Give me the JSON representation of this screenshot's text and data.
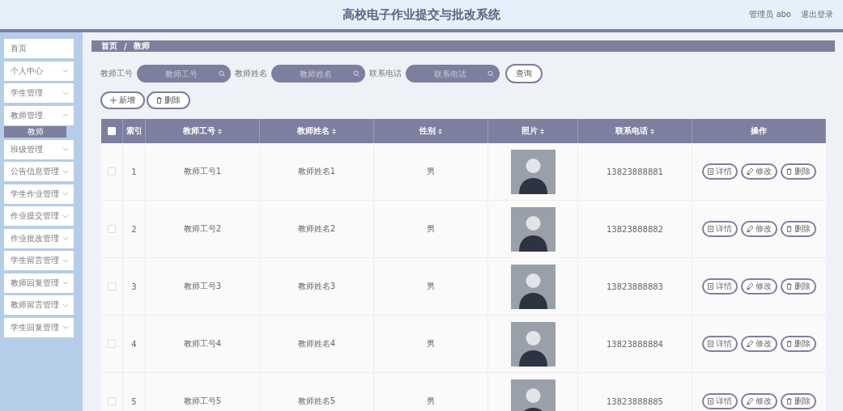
{
  "header": {
    "title": "高校电子作业提交与批改系统",
    "user": "管理员 abo",
    "logout": "退出登录"
  },
  "sidebar": {
    "items": [
      {
        "label": "首页",
        "expandable": false
      },
      {
        "label": "个人中心",
        "expandable": true,
        "expanded": false
      },
      {
        "label": "学生管理",
        "expandable": true,
        "expanded": false
      },
      {
        "label": "教师管理",
        "expandable": true,
        "expanded": true,
        "children": [
          {
            "label": "教师",
            "selected": true
          }
        ]
      },
      {
        "label": "班级管理",
        "expandable": true,
        "expanded": false
      },
      {
        "label": "公告信息管理",
        "expandable": true,
        "expanded": false
      },
      {
        "label": "学生作业管理",
        "expandable": true,
        "expanded": false
      },
      {
        "label": "作业提交管理",
        "expandable": true,
        "expanded": false
      },
      {
        "label": "作业批改管理",
        "expandable": true,
        "expanded": false
      },
      {
        "label": "学生留言管理",
        "expandable": true,
        "expanded": false
      },
      {
        "label": "教师回复管理",
        "expandable": true,
        "expanded": false
      },
      {
        "label": "教师留言管理",
        "expandable": true,
        "expanded": false
      },
      {
        "label": "学生回复管理",
        "expandable": true,
        "expanded": false
      }
    ]
  },
  "breadcrumb": {
    "items": [
      "首页",
      "教师"
    ],
    "separator": "/"
  },
  "search": {
    "fields": [
      {
        "label": "教师工号",
        "placeholder": "教师工号"
      },
      {
        "label": "教师姓名",
        "placeholder": "教师姓名"
      },
      {
        "label": "联系电话",
        "placeholder": "联系电话"
      }
    ],
    "button": "查询"
  },
  "actions": [
    {
      "kind": "add",
      "label": "新增"
    },
    {
      "kind": "delete",
      "label": "删除"
    }
  ],
  "table": {
    "select_all_checked": false,
    "columns": [
      {
        "label": "索引",
        "sortable": false
      },
      {
        "label": "教师工号",
        "sortable": true
      },
      {
        "label": "教师姓名",
        "sortable": true
      },
      {
        "label": "性别",
        "sortable": true
      },
      {
        "label": "照片",
        "sortable": true
      },
      {
        "label": "联系电话",
        "sortable": true
      },
      {
        "label": "操作",
        "sortable": false
      }
    ],
    "rows": [
      {
        "index": "1",
        "id": "教师工号1",
        "name": "教师姓名1",
        "gender": "男",
        "phone": "13823888881",
        "checked": false,
        "actions": [
          {
            "kind": "detail",
            "label": "详情"
          },
          {
            "kind": "edit",
            "label": "修改"
          },
          {
            "kind": "delete",
            "label": "删除"
          }
        ]
      },
      {
        "index": "2",
        "id": "教师工号2",
        "name": "教师姓名2",
        "gender": "男",
        "phone": "13823888882",
        "checked": false,
        "actions": [
          {
            "kind": "detail",
            "label": "详情"
          },
          {
            "kind": "edit",
            "label": "修改"
          },
          {
            "kind": "delete",
            "label": "删除"
          }
        ]
      },
      {
        "index": "3",
        "id": "教师工号3",
        "name": "教师姓名3",
        "gender": "男",
        "phone": "13823888883",
        "checked": false,
        "actions": [
          {
            "kind": "detail",
            "label": "详情"
          },
          {
            "kind": "edit",
            "label": "修改"
          },
          {
            "kind": "delete",
            "label": "删除"
          }
        ]
      },
      {
        "index": "4",
        "id": "教师工号4",
        "name": "教师姓名4",
        "gender": "男",
        "phone": "13823888884",
        "checked": false,
        "actions": [
          {
            "kind": "detail",
            "label": "详情"
          },
          {
            "kind": "edit",
            "label": "修改"
          },
          {
            "kind": "delete",
            "label": "删除"
          }
        ]
      },
      {
        "index": "5",
        "id": "教师工号5",
        "name": "教师姓名5",
        "gender": "男",
        "phone": "13823888885",
        "checked": false,
        "actions": [
          {
            "kind": "detail",
            "label": "详情"
          },
          {
            "kind": "edit",
            "label": "修改"
          },
          {
            "kind": "delete",
            "label": "删除"
          }
        ]
      }
    ]
  }
}
